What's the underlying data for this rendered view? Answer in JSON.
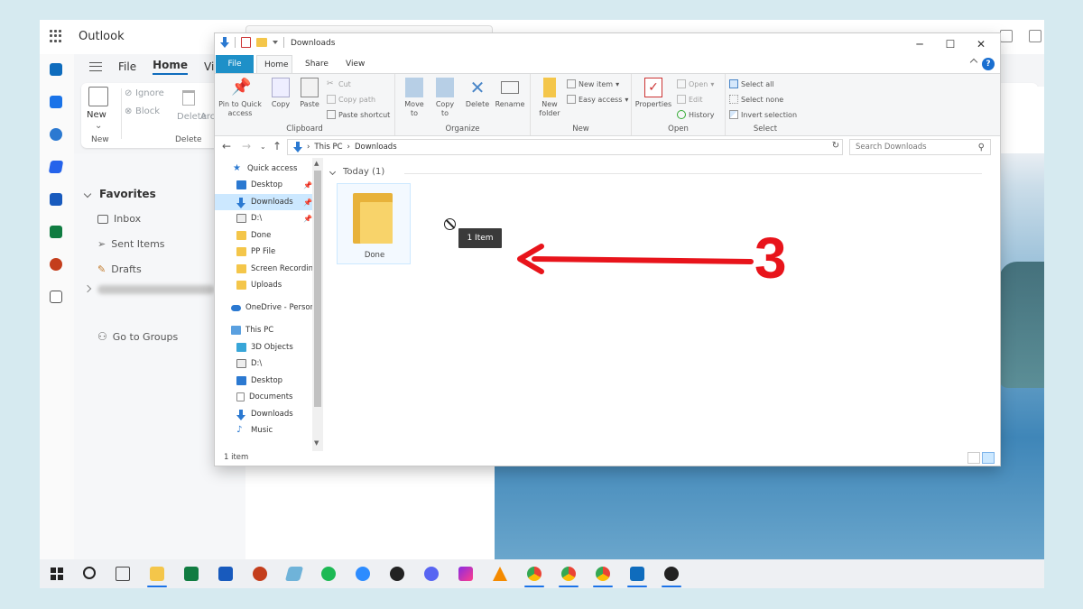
{
  "outlook": {
    "app_title": "Outlook",
    "menu": {
      "file": "File",
      "home": "Home",
      "view": "View"
    },
    "commands": {
      "new": "New",
      "ignore": "Ignore",
      "block": "Block",
      "delete": "Delete",
      "archive": "Arc"
    },
    "groups": {
      "new": "New",
      "delete": "Delete"
    },
    "nav": {
      "favorites": "Favorites",
      "inbox": "Inbox",
      "sent": "Sent Items",
      "drafts": "Drafts",
      "groups": "Go to Groups"
    }
  },
  "explorer": {
    "title": "Downloads",
    "tabs": {
      "file": "File",
      "home": "Home",
      "share": "Share",
      "view": "View"
    },
    "help": "?",
    "ribbon": {
      "clipboard": {
        "label": "Clipboard",
        "pin_line1": "Pin to Quick",
        "pin_line2": "access",
        "copy": "Copy",
        "paste": "Paste",
        "cut": "Cut",
        "copy_path": "Copy path",
        "paste_shortcut": "Paste shortcut"
      },
      "organize": {
        "label": "Organize",
        "move_line1": "Move",
        "move_line2": "to",
        "copy_line1": "Copy",
        "copy_line2": "to",
        "delete": "Delete",
        "rename": "Rename"
      },
      "new": {
        "label": "New",
        "new_folder_line1": "New",
        "new_folder_line2": "folder",
        "new_item": "New item",
        "easy_access": "Easy access"
      },
      "open": {
        "label": "Open",
        "properties": "Properties",
        "open": "Open",
        "edit": "Edit",
        "history": "History"
      },
      "select": {
        "label": "Select",
        "select_all": "Select all",
        "select_none": "Select none",
        "invert": "Invert selection"
      }
    },
    "address": {
      "this_pc": "This PC",
      "downloads": "Downloads",
      "sep": "›"
    },
    "search_placeholder": "Search Downloads",
    "nav_pane": {
      "quick_access": "Quick access",
      "desktop": "Desktop",
      "downloads": "Downloads",
      "d_drive": "D:\\",
      "done": "Done",
      "pp_file": "PP File",
      "screen_recordings": "Screen Recordin",
      "uploads": "Uploads",
      "onedrive": "OneDrive - Persor",
      "this_pc": "This PC",
      "objects_3d": "3D Objects",
      "d_drive2": "D:\\",
      "desktop2": "Desktop",
      "documents": "Documents",
      "downloads2": "Downloads",
      "music": "Music"
    },
    "content": {
      "group_header": "Today (1)",
      "item_name": "Done",
      "drag_tooltip": "1 Item"
    },
    "status": "1 item"
  },
  "annotation": {
    "step_number": "3",
    "color": "#e8141b"
  },
  "colors": {
    "accent": "#1e90c8",
    "selection": "#cce8ff",
    "folder": "#f8d36a"
  }
}
